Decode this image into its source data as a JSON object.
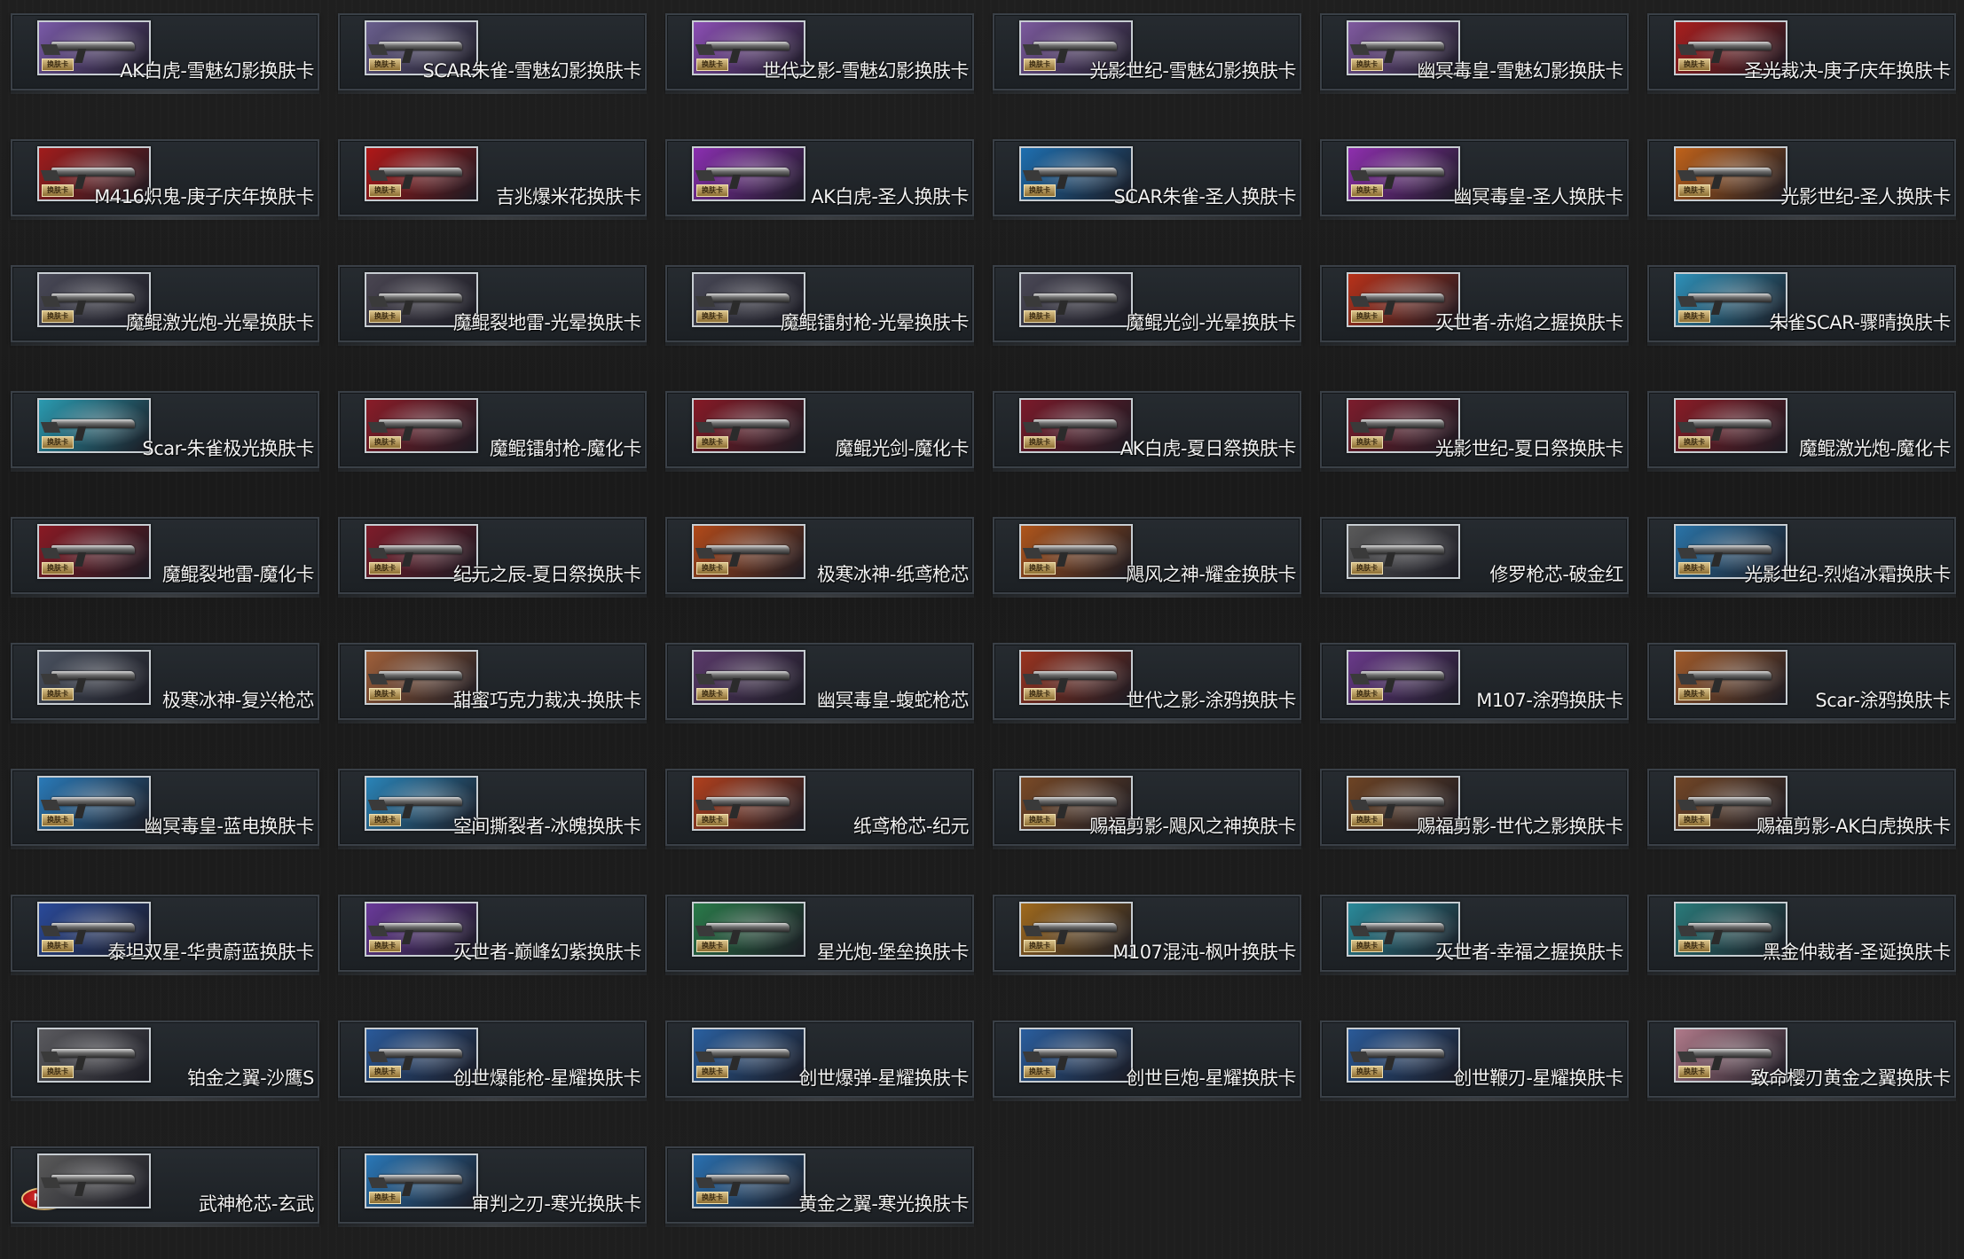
{
  "cards": [
    {
      "label": "AK白虎-雪魅幻影换肤卡",
      "color": "#7a5aa8",
      "tag": "换肤卡"
    },
    {
      "label": "SCAR朱雀-雪魅幻影换肤卡",
      "color": "#6a5f8e",
      "tag": "换肤卡"
    },
    {
      "label": "世代之影-雪魅幻影换肤卡",
      "color": "#8c4fb5",
      "tag": "换肤卡"
    },
    {
      "label": "光影世纪-雪魅幻影换肤卡",
      "color": "#7c5a9e",
      "tag": "换肤卡"
    },
    {
      "label": "幽冥毒皇-雪魅幻影换肤卡",
      "color": "#805aa0",
      "tag": "换肤卡"
    },
    {
      "label": "圣光裁决-庚子庆年换肤卡",
      "color": "#a81e1e",
      "tag": "换肤卡"
    },
    {
      "label": "M416炽鬼-庚子庆年换肤卡",
      "color": "#a11c1c",
      "tag": "换肤卡"
    },
    {
      "label": "吉兆爆米花换肤卡",
      "color": "#b01818",
      "tag": "换肤卡"
    },
    {
      "label": "AK白虎-圣人换肤卡",
      "color": "#8a2fb0",
      "tag": "换肤卡"
    },
    {
      "label": "SCAR朱雀-圣人换肤卡",
      "color": "#1e6fb0",
      "tag": "换肤卡"
    },
    {
      "label": "幽冥毒皇-圣人换肤卡",
      "color": "#8e2fae",
      "tag": "换肤卡"
    },
    {
      "label": "光影世纪-圣人换肤卡",
      "color": "#c0621a",
      "tag": "换肤卡"
    },
    {
      "label": "魔鲲激光炮-光晕换肤卡",
      "color": "#4a4a58",
      "tag": "换肤卡"
    },
    {
      "label": "魔鲲裂地雷-光晕换肤卡",
      "color": "#4a4652",
      "tag": "换肤卡"
    },
    {
      "label": "魔鲲镭射枪-光晕换肤卡",
      "color": "#484856",
      "tag": "换肤卡"
    },
    {
      "label": "魔鲲光剑-光晕换肤卡",
      "color": "#4a4856",
      "tag": "换肤卡"
    },
    {
      "label": "灭世者-赤焰之握换肤卡",
      "color": "#b8321a",
      "tag": "换肤卡"
    },
    {
      "label": "朱雀SCAR-骤晴换肤卡",
      "color": "#2e90b8",
      "tag": "换肤卡"
    },
    {
      "label": "Scar-朱雀极光换肤卡",
      "color": "#2a9ab0",
      "tag": "换肤卡"
    },
    {
      "label": "魔鲲镭射枪-魔化卡",
      "color": "#8a1c28",
      "tag": "换肤卡"
    },
    {
      "label": "魔鲲光剑-魔化卡",
      "color": "#861a26",
      "tag": "换肤卡"
    },
    {
      "label": "AK白虎-夏日祭换肤卡",
      "color": "#7a1a2a",
      "tag": "换肤卡"
    },
    {
      "label": "光影世纪-夏日祭换肤卡",
      "color": "#7c1c2c",
      "tag": "换肤卡"
    },
    {
      "label": "魔鲲激光炮-魔化卡",
      "color": "#881c26",
      "tag": "换肤卡"
    },
    {
      "label": "魔鲲裂地雷-魔化卡",
      "color": "#8a1a24",
      "tag": "换肤卡"
    },
    {
      "label": "纪元之辰-夏日祭换肤卡",
      "color": "#7e1c2a",
      "tag": "换肤卡"
    },
    {
      "label": "极寒冰神-纸鸢枪芯",
      "color": "#b24a1a",
      "tag": "换肤卡"
    },
    {
      "label": "飓风之神-耀金换肤卡",
      "color": "#b0561c",
      "tag": "换肤卡"
    },
    {
      "label": "修罗枪芯-破金红",
      "color": "#5a5a5a",
      "tag": "换肤卡"
    },
    {
      "label": "光影世纪-烈焰冰霜换肤卡",
      "color": "#2a74a8",
      "tag": "换肤卡"
    },
    {
      "label": "极寒冰神-复兴枪芯",
      "color": "#4a5260",
      "tag": "换肤卡"
    },
    {
      "label": "甜蜜巧克力裁决-换肤卡",
      "color": "#a0603a",
      "tag": "换肤卡"
    },
    {
      "label": "幽冥毒皇-蝮蛇枪芯",
      "color": "#5a3a6a",
      "tag": "换肤卡"
    },
    {
      "label": "世代之影-涂鸦换肤卡",
      "color": "#9a3420",
      "tag": "换肤卡"
    },
    {
      "label": "M107-涂鸦换肤卡",
      "color": "#6a3a8a",
      "tag": "换肤卡"
    },
    {
      "label": "Scar-涂鸦换肤卡",
      "color": "#a05a2a",
      "tag": "换肤卡"
    },
    {
      "label": "幽冥毒皇-蓝电换肤卡",
      "color": "#2a7ab8",
      "tag": "换肤卡"
    },
    {
      "label": "空间撕裂者-冰魄换肤卡",
      "color": "#2a84b8",
      "tag": "换肤卡"
    },
    {
      "label": "纸鸢枪芯-纪元",
      "color": "#b0401e",
      "tag": "换肤卡"
    },
    {
      "label": "赐福剪影-飓风之神换肤卡",
      "color": "#7a4a26",
      "tag": "换肤卡"
    },
    {
      "label": "赐福剪影-世代之影换肤卡",
      "color": "#6e4424",
      "tag": "换肤卡"
    },
    {
      "label": "赐福剪影-AK白虎换肤卡",
      "color": "#724626",
      "tag": "换肤卡"
    },
    {
      "label": "泰坦双星-华贵蔚蓝换肤卡",
      "color": "#2a4a9a",
      "tag": "换肤卡"
    },
    {
      "label": "灭世者-巅峰幻紫换肤卡",
      "color": "#6a3a9a",
      "tag": "换肤卡"
    },
    {
      "label": "星光炮-堡垒换肤卡",
      "color": "#2a7a4a",
      "tag": "换肤卡"
    },
    {
      "label": "M107混沌-枫叶换肤卡",
      "color": "#a06a1e",
      "tag": "换肤卡"
    },
    {
      "label": "灭世者-幸福之握换肤卡",
      "color": "#2a8a9a",
      "tag": "换肤卡"
    },
    {
      "label": "黑金仲裁者-圣诞换肤卡",
      "color": "#2a7a7a",
      "tag": "换肤卡"
    },
    {
      "label": "铂金之翼-沙鹰S",
      "color": "#5a5a5e",
      "tag": "换肤卡"
    },
    {
      "label": "创世爆能枪-星耀换肤卡",
      "color": "#2a5a9a",
      "tag": "换肤卡"
    },
    {
      "label": "创世爆弹-星耀换肤卡",
      "color": "#2a60a0",
      "tag": "换肤卡"
    },
    {
      "label": "创世巨炮-星耀换肤卡",
      "color": "#2a5e9e",
      "tag": "换肤卡"
    },
    {
      "label": "创世鞭刃-星耀换肤卡",
      "color": "#2a5a98",
      "tag": "换肤卡"
    },
    {
      "label": "致命樱刃黄金之翼换肤卡",
      "color": "#b07a8a",
      "tag": "换肤卡"
    },
    {
      "label": "武神枪芯-玄武",
      "color": "#5a5a5a",
      "tag": "NSL"
    },
    {
      "label": "审判之刃-寒光换肤卡",
      "color": "#2a78b8",
      "tag": "换肤卡"
    },
    {
      "label": "黄金之翼-寒光换肤卡",
      "color": "#2a70b0",
      "tag": "换肤卡"
    }
  ]
}
